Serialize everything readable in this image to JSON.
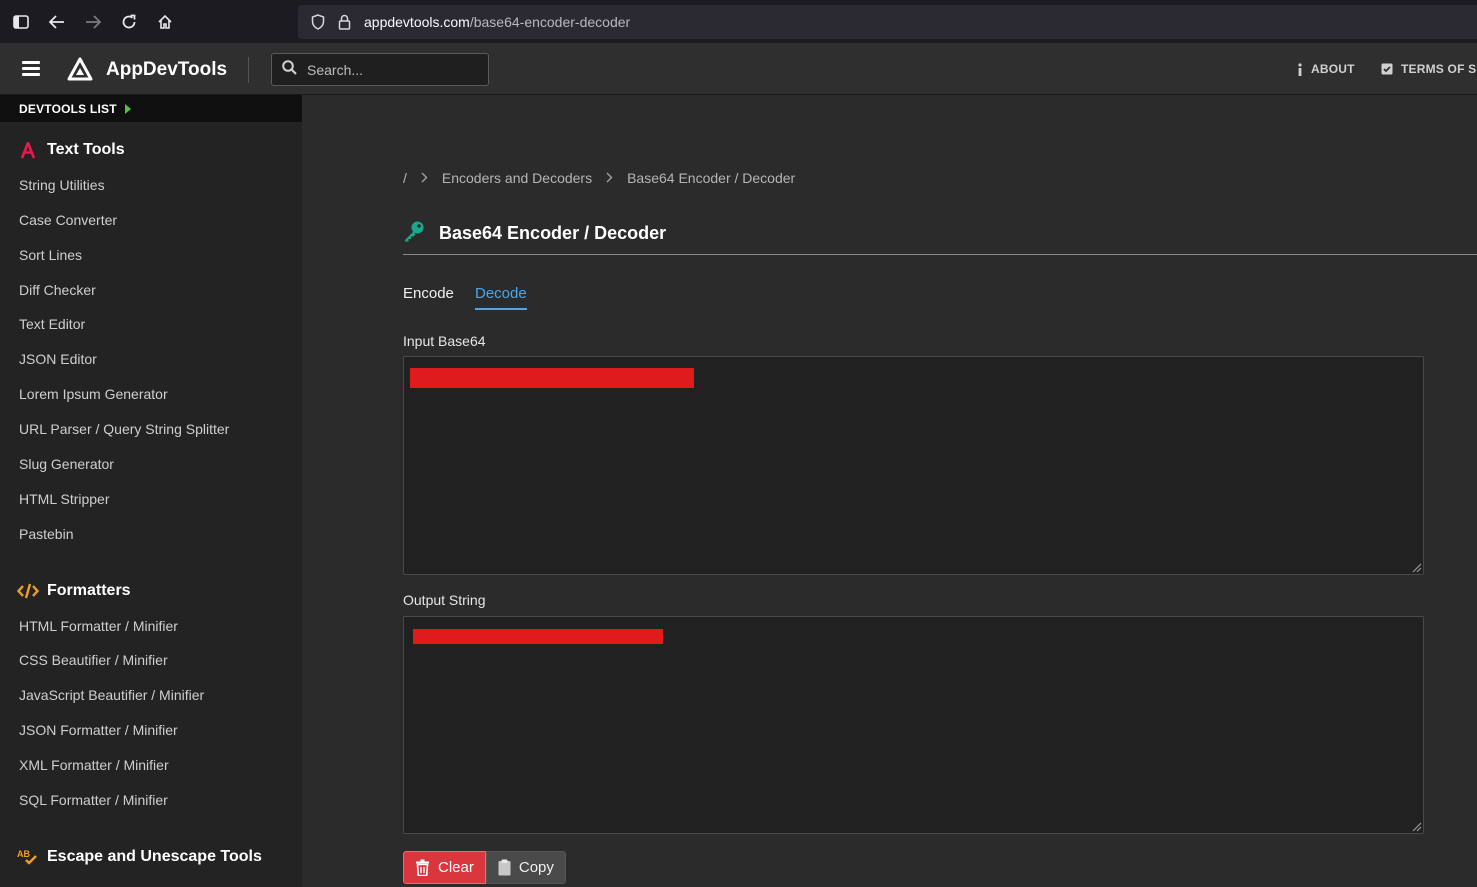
{
  "browser": {
    "url_host": "appdevtools.com",
    "url_path": "/base64-encoder-decoder"
  },
  "header": {
    "brand": "AppDevTools",
    "search_placeholder": "Search...",
    "about_label": "ABOUT",
    "terms_label": "TERMS OF S"
  },
  "sidebar": {
    "devtools_list_label": "DEVTOOLS LIST",
    "sections": [
      {
        "title": "Text Tools",
        "icon": "font-a-icon",
        "items": [
          "String Utilities",
          "Case Converter",
          "Sort Lines",
          "Diff Checker",
          "Text Editor",
          "JSON Editor",
          "Lorem Ipsum Generator",
          "URL Parser / Query String Splitter",
          "Slug Generator",
          "HTML Stripper",
          "Pastebin"
        ]
      },
      {
        "title": "Formatters",
        "icon": "code-brackets-icon",
        "items": [
          "HTML Formatter / Minifier",
          "CSS Beautifier / Minifier",
          "JavaScript Beautifier / Minifier",
          "JSON Formatter / Minifier",
          "XML Formatter / Minifier",
          "SQL Formatter / Minifier"
        ]
      },
      {
        "title": "Escape and Unescape Tools",
        "icon": "spellcheck-icon",
        "items": []
      }
    ]
  },
  "main": {
    "breadcrumb": [
      "/",
      "Encoders and Decoders",
      "Base64 Encoder / Decoder"
    ],
    "title": "Base64 Encoder / Decoder",
    "title_icon": "key-icon",
    "tabs": [
      {
        "label": "Encode",
        "active": false
      },
      {
        "label": "Decode",
        "active": true
      }
    ],
    "input_label": "Input Base64",
    "output_label": "Output String",
    "clear_label": "Clear",
    "copy_label": "Copy"
  },
  "colors": {
    "accent_blue": "#4aa8ea",
    "clear_red": "#d9363e",
    "redaction": "#e01b1b",
    "devtools_arrow": "#55c244",
    "text_tools_icon": "#e8194f",
    "formatters_icon": "#f0a020",
    "key_icon": "#1aa88a"
  }
}
